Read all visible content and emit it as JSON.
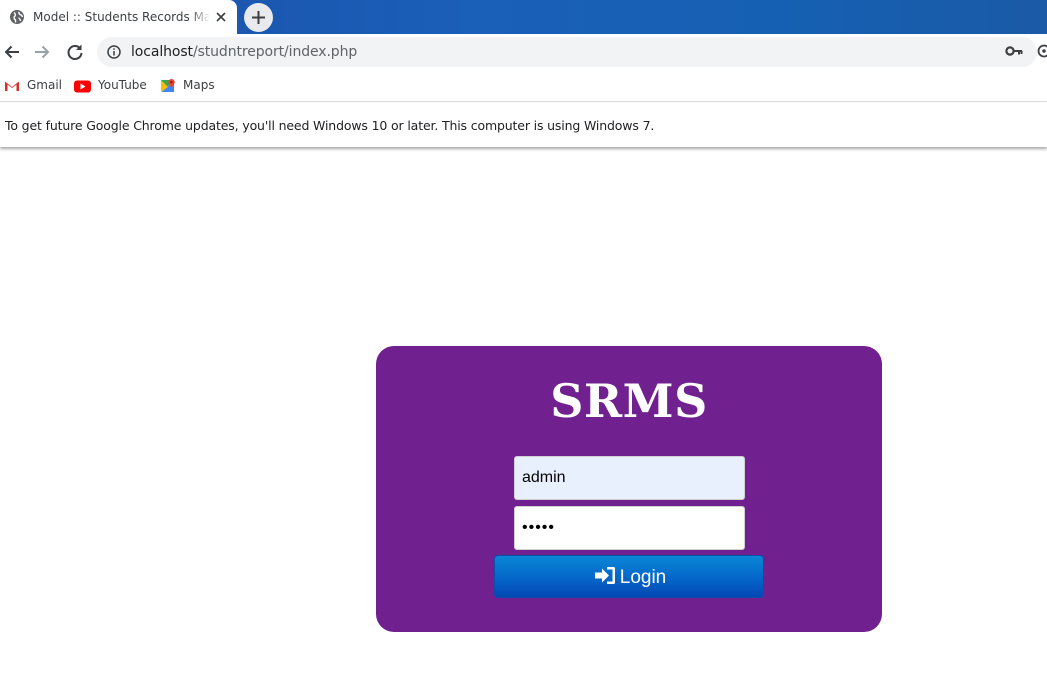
{
  "browser": {
    "tab": {
      "title": "Model :: Students Records Management System",
      "favicon": "globe-icon",
      "close_icon": "close-icon"
    },
    "new_tab_icon": "plus-icon",
    "nav": {
      "back_icon": "arrow-left-icon",
      "forward_icon": "arrow-right-icon",
      "reload_icon": "reload-icon"
    },
    "omnibox": {
      "host": "localhost",
      "path": "/studntreport/index.php",
      "info_icon": "info-icon"
    },
    "toolbar_icons": [
      "key-icon",
      "extension-icon"
    ],
    "bookmarks": [
      {
        "label": "Gmail",
        "icon": "gmail-icon"
      },
      {
        "label": "YouTube",
        "icon": "youtube-icon"
      },
      {
        "label": "Maps",
        "icon": "maps-icon"
      }
    ],
    "infobar_text": "To get future Google Chrome updates, you'll need Windows 10 or later. This computer is using Windows 7."
  },
  "login": {
    "title": "SRMS",
    "username_value": "admin",
    "password_value": "•••••",
    "button_label": "Login",
    "button_icon": "sign-in-icon"
  },
  "colors": {
    "card_bg": "#71208f",
    "button_bg": "#0566c9",
    "tabstrip_bg": "#1a5fb8",
    "username_field_bg": "#e8f0fe"
  }
}
